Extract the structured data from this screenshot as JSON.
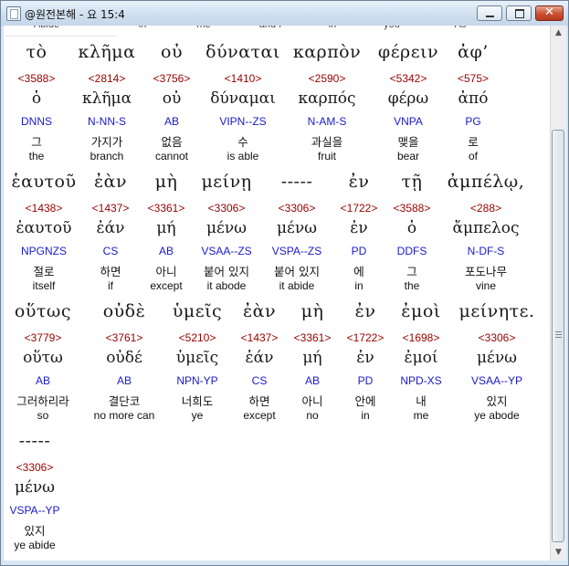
{
  "window": {
    "title": "@원전본해 - 요 15:4",
    "minimize_symbol": "",
    "maximize_symbol": "",
    "close_symbol": "✕"
  },
  "cutoff_row": [
    "Abide",
    "in",
    "me",
    "and I",
    "in",
    "you",
    "As"
  ],
  "verse_rows": [
    [
      {
        "greek": "τὸ",
        "strongs": "<3588>",
        "lemma": "ὁ",
        "parsing": "DNNS",
        "korean": "그",
        "english": "the"
      },
      {
        "greek": "κλῆμα",
        "strongs": "<2814>",
        "lemma": "κλῆμα",
        "parsing": "N-NN-S",
        "korean": "가지가",
        "english": "branch"
      },
      {
        "greek": "οὐ",
        "strongs": "<3756>",
        "lemma": "οὐ",
        "parsing": "AB",
        "korean": "없음",
        "english": "cannot"
      },
      {
        "greek": "δύναται",
        "strongs": "<1410>",
        "lemma": "δύναμαι",
        "parsing": "VIPN--ZS",
        "korean": "수",
        "english": "is able"
      },
      {
        "greek": "καρπὸν",
        "strongs": "<2590>",
        "lemma": "καρπός",
        "parsing": "N-AM-S",
        "korean": "과실을",
        "english": "fruit"
      },
      {
        "greek": "φέρειν",
        "strongs": "<5342>",
        "lemma": "φέρω",
        "parsing": "VNPA",
        "korean": "맺을",
        "english": "bear"
      },
      {
        "greek": "ἀφ’",
        "strongs": "<575>",
        "lemma": "ἀπό",
        "parsing": "PG",
        "korean": "로",
        "english": "of"
      }
    ],
    [
      {
        "greek": "ἑαυτοῦ",
        "strongs": "<1438>",
        "lemma": "ἑαυτοῦ",
        "parsing": "NPGNZS",
        "korean": "절로",
        "english": "itself"
      },
      {
        "greek": "ἐὰν",
        "strongs": "<1437>",
        "lemma": "ἐάν",
        "parsing": "CS",
        "korean": "하면",
        "english": "if"
      },
      {
        "greek": "μὴ",
        "strongs": "<3361>",
        "lemma": "μή",
        "parsing": "AB",
        "korean": "아니",
        "english": "except"
      },
      {
        "greek": "μείνῃ",
        "strongs": "<3306>",
        "lemma": "μένω",
        "parsing": "VSAA--ZS",
        "korean": "붙어 있지",
        "english": "it abode"
      },
      {
        "greek": "-----",
        "strongs": "<3306>",
        "lemma": "μένω",
        "parsing": "VSPA--ZS",
        "korean": "붙어 있지",
        "english": "it abide"
      },
      {
        "greek": "ἐν",
        "strongs": "<1722>",
        "lemma": "ἐν",
        "parsing": "PD",
        "korean": "에",
        "english": "in"
      },
      {
        "greek": "τῇ",
        "strongs": "<3588>",
        "lemma": "ὁ",
        "parsing": "DDFS",
        "korean": "그",
        "english": "the"
      },
      {
        "greek": "ἀμπέλῳ,",
        "strongs": "<288>",
        "lemma": "ἄμπελος",
        "parsing": "N-DF-S",
        "korean": "포도나무",
        "english": "vine"
      }
    ],
    [
      {
        "greek": "οὕτως",
        "strongs": "<3779>",
        "lemma": "οὕτω",
        "parsing": "AB",
        "korean": "그러하리라",
        "english": "so"
      },
      {
        "greek": "οὐδὲ",
        "strongs": "<3761>",
        "lemma": "οὐδέ",
        "parsing": "AB",
        "korean": "결단코",
        "english": "no more can"
      },
      {
        "greek": "ὑμεῖς",
        "strongs": "<5210>",
        "lemma": "ὑμεῖς",
        "parsing": "NPN-YP",
        "korean": "너희도",
        "english": "ye"
      },
      {
        "greek": "ἐὰν",
        "strongs": "<1437>",
        "lemma": "ἐάν",
        "parsing": "CS",
        "korean": "하면",
        "english": "except"
      },
      {
        "greek": "μὴ",
        "strongs": "<3361>",
        "lemma": "μή",
        "parsing": "AB",
        "korean": "아니",
        "english": "no"
      },
      {
        "greek": "ἐν",
        "strongs": "<1722>",
        "lemma": "ἐν",
        "parsing": "PD",
        "korean": "안에",
        "english": "in"
      },
      {
        "greek": "ἐμοὶ",
        "strongs": "<1698>",
        "lemma": "ἐμοί",
        "parsing": "NPD-XS",
        "korean": "내",
        "english": "me"
      },
      {
        "greek": "μείνητε.",
        "strongs": "<3306>",
        "lemma": "μένω",
        "parsing": "VSAA--YP",
        "korean": "있지",
        "english": "ye abode"
      }
    ],
    [
      {
        "greek": "-----",
        "strongs": "<3306>",
        "lemma": "μένω",
        "parsing": "VSPA--YP",
        "korean": "있지",
        "english": "ye abide"
      }
    ]
  ],
  "scrollbar": {
    "up_arrow": "▲",
    "down_arrow": "▼",
    "grip": "≡"
  },
  "colors": {
    "strongs": "#990000",
    "parsing": "#1a1acc",
    "text": "#1a1a1a"
  }
}
